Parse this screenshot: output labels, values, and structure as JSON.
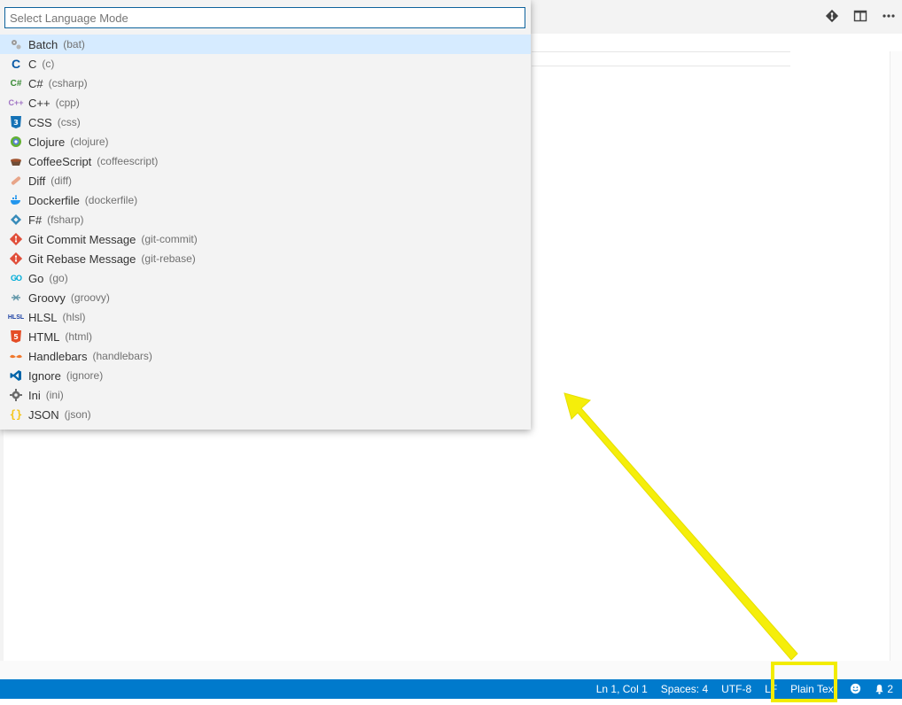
{
  "quick_pick": {
    "placeholder": "Select Language Mode",
    "items": [
      {
        "label": "Batch",
        "desc": "(bat)",
        "icon": "gears-icon"
      },
      {
        "label": "C",
        "desc": "(c)",
        "icon": "c-icon"
      },
      {
        "label": "C#",
        "desc": "(csharp)",
        "icon": "csharp-icon"
      },
      {
        "label": "C++",
        "desc": "(cpp)",
        "icon": "cpp-icon"
      },
      {
        "label": "CSS",
        "desc": "(css)",
        "icon": "css-icon"
      },
      {
        "label": "Clojure",
        "desc": "(clojure)",
        "icon": "clojure-icon"
      },
      {
        "label": "CoffeeScript",
        "desc": "(coffeescript)",
        "icon": "coffee-icon"
      },
      {
        "label": "Diff",
        "desc": "(diff)",
        "icon": "bandage-icon"
      },
      {
        "label": "Dockerfile",
        "desc": "(dockerfile)",
        "icon": "docker-whale-icon"
      },
      {
        "label": "F#",
        "desc": "(fsharp)",
        "icon": "fsharp-icon"
      },
      {
        "label": "Git Commit Message",
        "desc": "(git-commit)",
        "icon": "git-icon"
      },
      {
        "label": "Git Rebase Message",
        "desc": "(git-rebase)",
        "icon": "git-icon"
      },
      {
        "label": "Go",
        "desc": "(go)",
        "icon": "go-icon"
      },
      {
        "label": "Groovy",
        "desc": "(groovy)",
        "icon": "groovy-icon"
      },
      {
        "label": "HLSL",
        "desc": "(hlsl)",
        "icon": "hlsl-icon"
      },
      {
        "label": "HTML",
        "desc": "(html)",
        "icon": "html5-icon"
      },
      {
        "label": "Handlebars",
        "desc": "(handlebars)",
        "icon": "mustache-icon"
      },
      {
        "label": "Ignore",
        "desc": "(ignore)",
        "icon": "vscode-icon"
      },
      {
        "label": "Ini",
        "desc": "(ini)",
        "icon": "gear-icon"
      },
      {
        "label": "JSON",
        "desc": "(json)",
        "icon": "braces-icon"
      }
    ]
  },
  "statusbar": {
    "position": "Ln 1, Col 1",
    "indent": "Spaces: 4",
    "encoding": "UTF-8",
    "eol": "LF",
    "language": "Plain Text",
    "notifications": "2"
  },
  "colors": {
    "statusbar_bg": "#007acc",
    "highlight": "#f2ec00",
    "selected_item": "#d6ebff"
  }
}
